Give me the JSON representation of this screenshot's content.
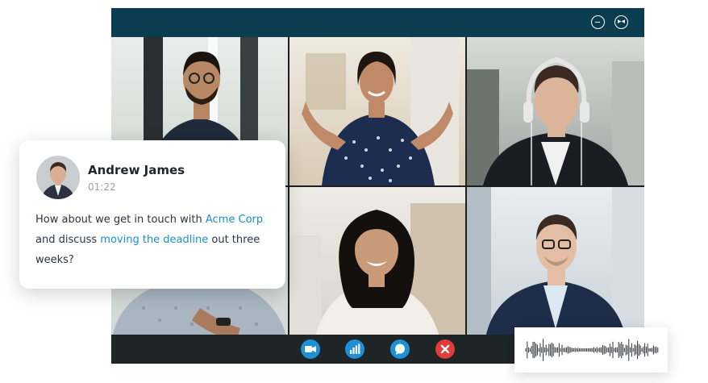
{
  "window": {
    "controls": {
      "minimize_icon": "minimize-icon",
      "popout_icon": "popout-icon",
      "popout_glyph": "▸◂"
    }
  },
  "participants": [
    {
      "id": "p1",
      "desc_skin": "#b88763",
      "shirt": "#1f2a3a",
      "hair": "#1a1410"
    },
    {
      "id": "p2",
      "desc_skin": "#c08a68",
      "shirt": "#1d2d4f",
      "hair": "#1e1510"
    },
    {
      "id": "p3",
      "desc_skin": "#dcb49a",
      "shirt": "#1a1d22",
      "hair": "#3a2a20"
    },
    {
      "id": "p4",
      "desc_skin": "#a97a5c",
      "shirt": "#a9b6c1",
      "hair": "#1a1410"
    },
    {
      "id": "p5",
      "desc_skin": "#c99a78",
      "shirt": "#f3efe8",
      "hair": "#14100d"
    },
    {
      "id": "p6",
      "desc_skin": "#e3bea4",
      "shirt": "#1d2d4a",
      "hair": "#3a2b22"
    }
  ],
  "call_controls": [
    {
      "name": "video-icon"
    },
    {
      "name": "signal-bars-icon"
    },
    {
      "name": "chat-icon"
    },
    {
      "name": "end-call-icon"
    }
  ],
  "chat": {
    "name": "Andrew James",
    "time": "01:22",
    "message_parts": {
      "a": "How about we get in touch with ",
      "b": "Acme Corp",
      "c": " and discuss ",
      "d": "moving the deadline",
      "e": " out three weeks?"
    }
  },
  "colors": {
    "titlebar": "#0c3c50",
    "accent": "#1a8ed1",
    "end_call": "#e23b3b"
  }
}
